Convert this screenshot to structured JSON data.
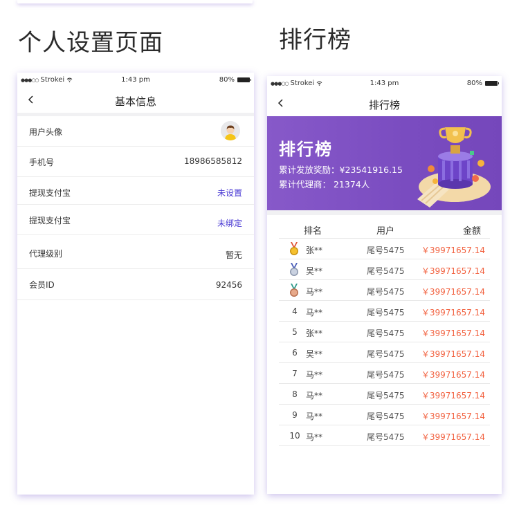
{
  "left_title": "个人设置页面",
  "right_title": "排行榜",
  "status": {
    "carrier": "Strokei",
    "time": "1:43 pm",
    "battery": "80%"
  },
  "settings": {
    "nav_title": "基本信息",
    "rows": [
      {
        "label": "用户头像"
      },
      {
        "label": "手机号",
        "value": "18986585812"
      },
      {
        "label": "提现支付宝",
        "value": "未设置"
      },
      {
        "label": "提现支付宝",
        "value": "未绑定"
      },
      {
        "label": "代理级别",
        "value": "暂无"
      },
      {
        "label": "会员ID",
        "value": "92456"
      }
    ]
  },
  "leaderboard": {
    "nav_title": "排行榜",
    "banner_title": "排行榜",
    "total_reward": "累计发放奖励：¥23541916.15",
    "total_agents": "累计代理商：  21374人",
    "headers": {
      "rank": "排名",
      "user": "用户",
      "amount": "金额"
    },
    "rows": [
      {
        "rank": "",
        "medal": "gold",
        "name": "张**",
        "user": "尾号5475",
        "amount": "￥39971657.14"
      },
      {
        "rank": "",
        "medal": "silver",
        "name": "吴**",
        "user": "尾号5475",
        "amount": "￥39971657.14"
      },
      {
        "rank": "",
        "medal": "bronze",
        "name": "马**",
        "user": "尾号5475",
        "amount": "￥39971657.14"
      },
      {
        "rank": "4",
        "name": "马**",
        "user": "尾号5475",
        "amount": "￥39971657.14"
      },
      {
        "rank": "5",
        "name": "张**",
        "user": "尾号5475",
        "amount": "￥39971657.14"
      },
      {
        "rank": "6",
        "name": "吴**",
        "user": "尾号5475",
        "amount": "￥39971657.14"
      },
      {
        "rank": "7",
        "name": "马**",
        "user": "尾号5475",
        "amount": "￥39971657.14"
      },
      {
        "rank": "8",
        "name": "马**",
        "user": "尾号5475",
        "amount": "￥39971657.14"
      },
      {
        "rank": "9",
        "name": "马**",
        "user": "尾号5475",
        "amount": "￥39971657.14"
      },
      {
        "rank": "10",
        "name": "马**",
        "user": "尾号5475",
        "amount": "￥39971657.14"
      }
    ]
  },
  "colors": {
    "link": "#4b3bd4",
    "amount": "#f2613f",
    "banner": "#8759c9"
  },
  "icons": [
    "signal-dots-icon",
    "wifi-icon",
    "battery-icon",
    "back-chevron-icon",
    "avatar-icon",
    "trophy-illustration",
    "gold-medal-icon",
    "silver-medal-icon",
    "bronze-medal-icon"
  ]
}
